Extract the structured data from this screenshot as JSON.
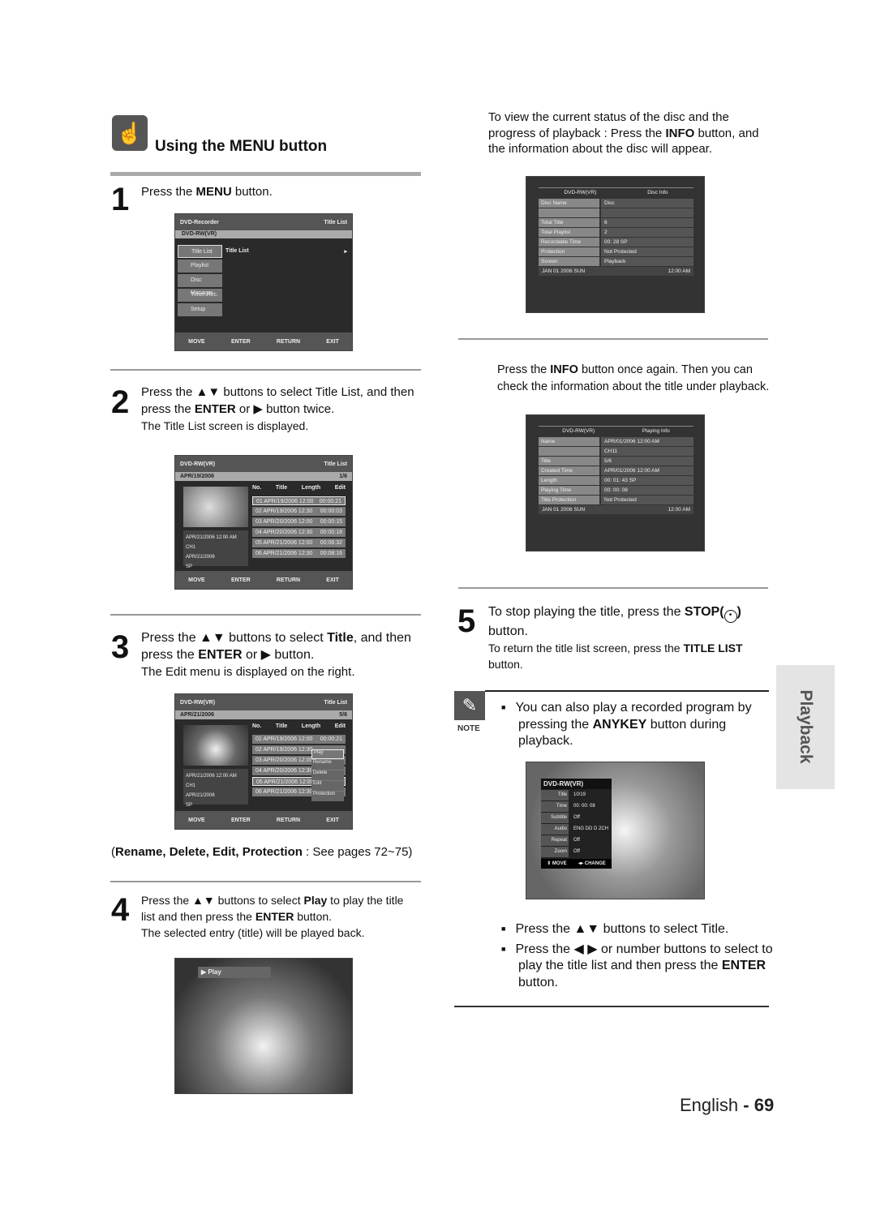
{
  "section": {
    "title": "Using the MENU button",
    "icon": "hand-pointer-icon"
  },
  "steps": {
    "s1": {
      "num": "1",
      "pre": "Press the ",
      "bold": "MENU",
      "post": " button."
    },
    "s2": {
      "num": "2",
      "l1": "Press the ▲▼ buttons to select Title List, and then",
      "l2_pre": "press the ",
      "l2_bold": "ENTER",
      "l2_post": " or ▶ button twice.",
      "sub": "The Title List screen is displayed."
    },
    "s3": {
      "num": "3",
      "l1_pre": "Press the ▲▼ buttons to select ",
      "l1_bold": "Title",
      "l1_post": ", and then",
      "l2_pre": "press the ",
      "l2_bold": "ENTER",
      "l2_post": " or ▶ button.",
      "sub": "The Edit menu is displayed on the right.",
      "ref_bold": "Rename, Delete, Edit, Protection",
      "ref_post": " : See pages 72~75)",
      "ref_open": "("
    },
    "s4": {
      "num": "4",
      "l1_pre": "Press the  ▲▼ buttons to select ",
      "l1_bold": "Play",
      "l1_post": " to play the title",
      "l2_pre": "list and then press the ",
      "l2_bold": "ENTER",
      "l2_post": " button.",
      "sub": "The selected entry (title) will be played back."
    },
    "s5": {
      "num": "5",
      "l1_pre": "To stop playing the title, press the ",
      "l1_bold": "STOP(",
      "l1_post": ")",
      "l2": "button.",
      "sub_pre": "To return the title list screen, press the ",
      "sub_bold": "TITLE LIST",
      "sub_post": "button."
    }
  },
  "info": {
    "p1": "To view the current status of the disc and the",
    "p2_pre": "progress of playback : Press the ",
    "p2_bold": "INFO",
    "p2_post": " button, and",
    "p3": "the information about the disc will appear.",
    "q1_pre": "Press the ",
    "q1_bold": "INFO",
    "q1_post": " button once again. Then you can",
    "q2": "check the information about the title under playback."
  },
  "note": {
    "label": "NOTE",
    "l1": "You can also play a recorded program by",
    "l2_pre": "pressing the ",
    "l2_bold": "ANYKEY",
    "l2_post": " button during",
    "l3": "playback."
  },
  "bullets": [
    {
      "text": "Press the ▲▼ buttons to select Title."
    },
    {
      "l1": "Press the ◀ ▶ or number buttons to select to",
      "l2_pre": "play the title list and then press the ",
      "l2_bold": "ENTER",
      "l3": "button."
    }
  ],
  "side_tab": "Playback",
  "footer": {
    "lang": "English",
    "sep": " - ",
    "page": "69"
  },
  "screen_menu": {
    "title": "DVD-Recorder",
    "right": "Title List",
    "disc": "DVD-RW(VR)",
    "items": [
      "Title List",
      "Playlist",
      "Disc Manager",
      "Timer Rec.",
      "Setup"
    ],
    "content": "Title List",
    "arrow": "▸"
  },
  "nav": {
    "move": "MOVE",
    "enter": "ENTER",
    "return": "RETURN",
    "exit": "EXIT"
  },
  "screen_list": {
    "disc": "DVD-RW(VR)",
    "right": "Title List",
    "date": "APR/19/2006",
    "count": "1/6",
    "cols": [
      "No.",
      "Title",
      "Length",
      "Edit"
    ],
    "rows": [
      [
        "01 APR/19/2006 12:00",
        "00:00:21"
      ],
      [
        "02 APR/19/2006 12:30",
        "00:00:03"
      ],
      [
        "03 APR/20/2006 12:00",
        "00:00:15"
      ],
      [
        "04 APR/20/2006 12:30",
        "00:00:18"
      ],
      [
        "05 APR/21/2006 12:00",
        "00:06:32"
      ],
      [
        "06 APR/21/2006 12:30",
        "00:08:16"
      ]
    ],
    "rec": "APR/21/2006 12:00 AM CH1",
    "d": "APR/21/2006",
    "q": "SP"
  },
  "screen_edit": {
    "date": "APR/21/2006",
    "count": "5/6",
    "menu": [
      "Play",
      "Rename",
      "Delete",
      "Edit",
      "Protection"
    ]
  },
  "screen_play": {
    "label": "▶ Play"
  },
  "disc_info": {
    "left": "DVD-RW(VR)",
    "right": "Disc Info",
    "rows": [
      [
        "Disc Name",
        "Disc"
      ],
      [
        "",
        ""
      ],
      [
        "Total Title",
        "6"
      ],
      [
        "Total Playlist",
        "2"
      ],
      [
        "Recordable Time",
        "00: 28 SP"
      ],
      [
        "Protection",
        "Not Protected"
      ],
      [
        "Screen",
        "Playback"
      ]
    ],
    "date": "JAN 01 2006 SUN",
    "time": "12:00 AM"
  },
  "play_info": {
    "left": "DVD-RW(VR)",
    "right": "Playing Info",
    "rows": [
      [
        "Name",
        "APR/01/2006 12:00 AM"
      ],
      [
        "",
        "CH11"
      ],
      [
        "Title",
        "5/6"
      ],
      [
        "Created Time",
        "APR/01/2006 12:00 AM"
      ],
      [
        "Length",
        "00: 01: 43   SP"
      ],
      [
        "Playing Time",
        "00: 00: 08"
      ],
      [
        "Title Protection",
        "Not Protected"
      ]
    ],
    "date": "JAN 01 2006 SUN",
    "time": "12:00 AM"
  },
  "anykey": {
    "title": "DVD-RW(VR)",
    "rows": [
      [
        "Title",
        "10/19"
      ],
      [
        "Time",
        "00: 00: 08"
      ],
      [
        "Subtitle",
        "Off"
      ],
      [
        "Audio",
        "ENG DD D 2CH"
      ],
      [
        "Repeat",
        "Off"
      ],
      [
        "Zoom",
        "Off"
      ]
    ],
    "move": "⇕ MOVE",
    "change": "◂▸ CHANGE"
  }
}
